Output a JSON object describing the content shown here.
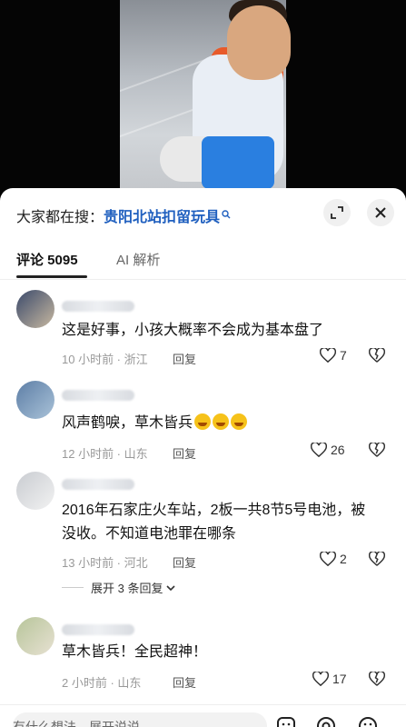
{
  "search": {
    "prefix": "大家都在搜：",
    "term": "贵阳北站扣留玩具"
  },
  "tabs": [
    {
      "label": "评论 5095"
    },
    {
      "label": "AI 解析"
    }
  ],
  "comments": [
    {
      "text": "这是好事，小孩大概率不会成为基本盘了",
      "meta": "10 小时前 · 浙江",
      "reply": "回复",
      "likes": "7"
    },
    {
      "text": "风声鹤唳，草木皆兵",
      "meta": "12 小时前 · 山东",
      "reply": "回复",
      "likes": "26"
    },
    {
      "text": "2016年石家庄火车站，2板一共8节5号电池，被没收。不知道电池罪在哪条",
      "meta": "13 小时前 · 河北",
      "reply": "回复",
      "likes": "2"
    },
    {
      "text": "草木皆兵！全民超神！",
      "meta": "2 小时前 · 山东",
      "reply": "回复",
      "likes": "17"
    }
  ],
  "expand_replies": "展开 3 条回复",
  "input": {
    "placeholder": "有什么想法，展开说说"
  },
  "icons": {
    "search_term": "search-icon",
    "expand": "expand-icon",
    "close": "close-icon",
    "like": "heart-icon",
    "dislike": "broken-heart-icon",
    "sticker": "sticker-icon",
    "mention": "at-icon",
    "emoji": "emoji-icon"
  }
}
